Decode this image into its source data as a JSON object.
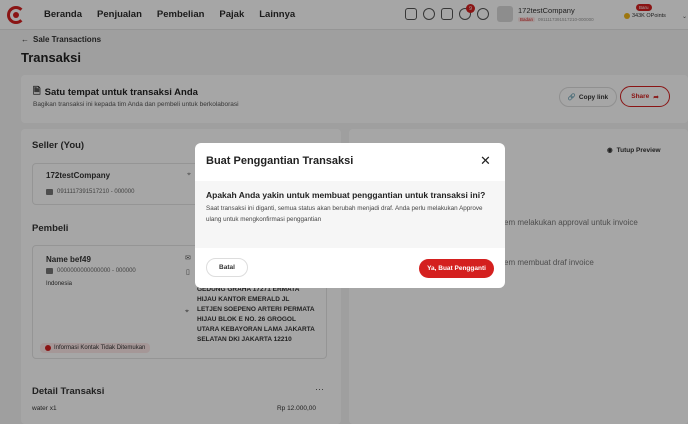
{
  "nav": {
    "items": [
      "Beranda",
      "Penjualan",
      "Pembelian",
      "Pajak",
      "Lainnya"
    ],
    "company_name": "172testCompany",
    "company_tag": "Badan",
    "company_id": "0911117391517210-000000",
    "points_badge": "Baru",
    "points": "343K OPoints",
    "notification_count": "9"
  },
  "page": {
    "back_label": "Sale Transactions",
    "title": "Transaksi"
  },
  "share_card": {
    "title": "Satu tempat untuk transaksi Anda",
    "subtitle": "Bagikan transaksi ini kepada tim Anda dan pembeli untuk berkolaborasi",
    "copy_link": "Copy link",
    "share": "Share"
  },
  "seller": {
    "section": "Seller (You)",
    "name": "172testCompany",
    "id": "0911117391517210 - 000000"
  },
  "buyer": {
    "section": "Pembeli",
    "name": "Name bef49",
    "id": "0000000000000000 - 000000",
    "country": "Indonesia",
    "address_lines": [
      "GEDUNG GRAHA 17271 ERMATA",
      "HIJAU KANTOR EMERALD JL",
      "LETJEN SOEPENO ARTERI PERMATA",
      "HIJAU BLOK E NO. 26 GROGOL",
      "UTARA KEBAYORAN LAMA JAKARTA",
      "SELATAN DKI JAKARTA 12210"
    ],
    "warning": "Informasi Kontak Tidak Ditemukan"
  },
  "detail": {
    "section": "Detail Transaksi",
    "item": "water  x1",
    "price": "Rp 12.000,00"
  },
  "preview": {
    "close_label": "Tutup Preview",
    "text1": "em melakukan approval untuk invoice",
    "text2": "em membuat draf invoice"
  },
  "modal": {
    "title": "Buat Penggantian Transaksi",
    "question": "Apakah Anda yakin untuk membuat penggantian untuk transaksi ini?",
    "description": "Saat transaksi ini diganti, semua status akan berubah menjadi draf. Anda perlu melakukan Approve ulang untuk mengkonfirmasi penggantian",
    "cancel": "Batal",
    "confirm": "Ya, Buat Pengganti"
  },
  "colors": {
    "brand": "#d4201f"
  }
}
